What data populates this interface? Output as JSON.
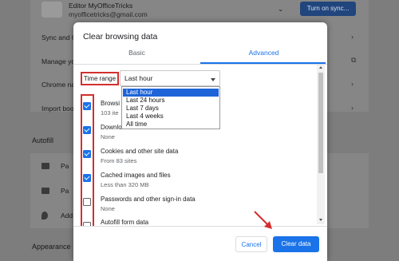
{
  "background": {
    "account_name": "Editor MyOfficeTricks",
    "account_email": "myofficetricks@gmail.com",
    "sync_button": "Turn on sync...",
    "rows": [
      "Sync and G",
      "Manage yo",
      "Chrome na",
      "Import boo"
    ],
    "autofill_heading": "Autofill",
    "autofill_rows": [
      "Pa",
      "Pa",
      "Add"
    ],
    "appearance_heading": "Appearance"
  },
  "dialog": {
    "title": "Clear browsing data",
    "tabs": {
      "basic": "Basic",
      "advanced": "Advanced"
    },
    "time_range_label": "Time range",
    "time_range_value": "Last hour",
    "time_range_options": [
      "Last hour",
      "Last 24 hours",
      "Last 7 days",
      "Last 4 weeks",
      "All time"
    ],
    "items": [
      {
        "title": "Browsi",
        "subtitle": "103 ite",
        "checked": true
      },
      {
        "title": "Downlo",
        "subtitle": "None",
        "checked": true
      },
      {
        "title": "Cookies and other site data",
        "subtitle": "From 83 sites",
        "checked": true
      },
      {
        "title": "Cached images and files",
        "subtitle": "Less than 320 MB",
        "checked": true
      },
      {
        "title": "Passwords and other sign-in data",
        "subtitle": "None",
        "checked": false
      },
      {
        "title": "Autofill form data",
        "subtitle": "",
        "checked": false
      }
    ],
    "cancel_label": "Cancel",
    "clear_label": "Clear data"
  },
  "colors": {
    "accent": "#1a73e8",
    "annotation": "#d32f2f"
  }
}
